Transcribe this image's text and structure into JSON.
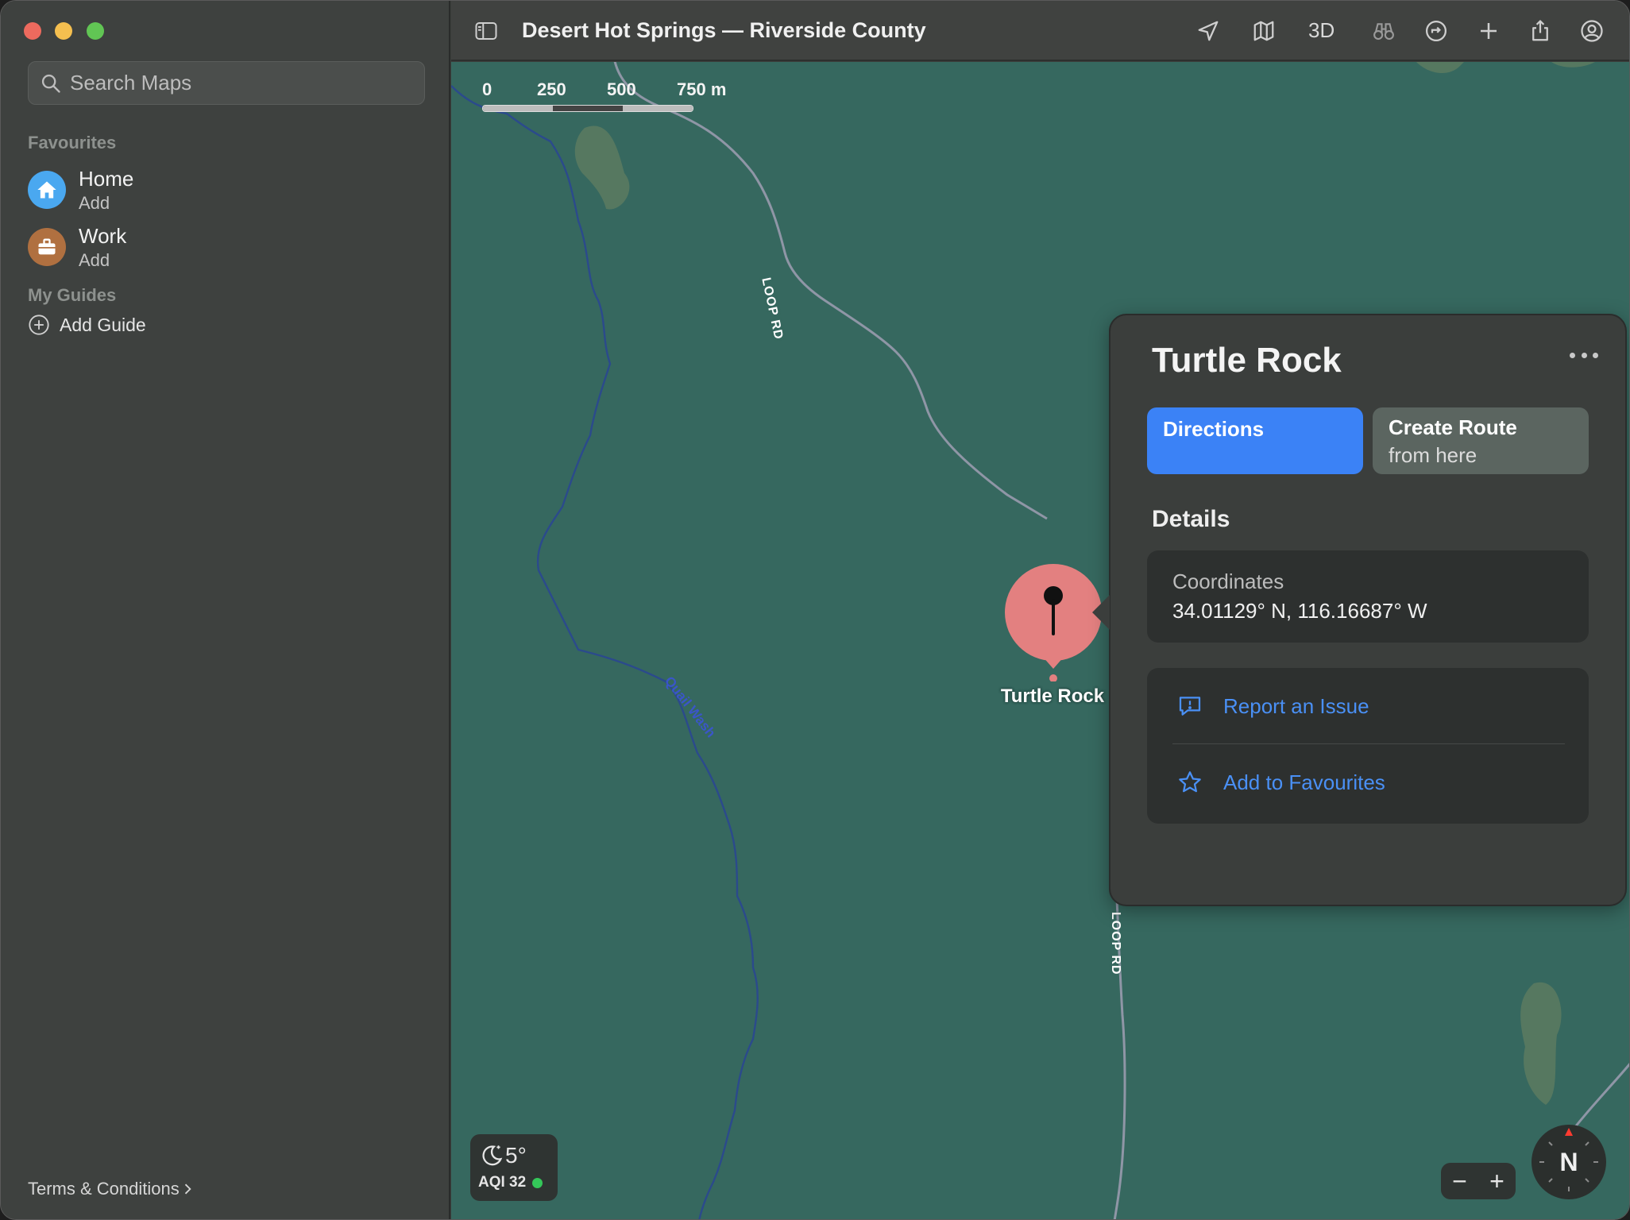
{
  "window": {
    "title": "Desert Hot Springs — Riverside County"
  },
  "sidebar": {
    "search_placeholder": "Search Maps",
    "favourites_label": "Favourites",
    "favourites": [
      {
        "title": "Home",
        "subtitle": "Add",
        "icon": "house-icon",
        "color": "#4aa8f0"
      },
      {
        "title": "Work",
        "subtitle": "Add",
        "icon": "briefcase-icon",
        "color": "#b07040"
      }
    ],
    "guides_label": "My Guides",
    "add_guide": "Add Guide",
    "terms": "Terms & Conditions"
  },
  "toolbar": {
    "sidebar_toggle": "sidebar-icon",
    "items": [
      "location-arrow-icon",
      "map-icon",
      "3D",
      "binoculars-icon",
      "rotate-icon",
      "plus-icon",
      "share-icon",
      "account-icon"
    ],
    "three_d_label": "3D"
  },
  "map": {
    "scale": {
      "labels": [
        "0",
        "250",
        "500",
        "750 m"
      ]
    },
    "road_labels": [
      "LOOP RD",
      "LOOP RD"
    ],
    "wash_label": "Quail Wash",
    "pin_label": "Turtle Rock",
    "weather": {
      "temperature": "5°",
      "aqi": "AQI 32",
      "aqi_color": "#34c759",
      "icon": "moon-stars-icon"
    },
    "zoom": {
      "minus": "−",
      "plus": "+"
    },
    "compass": "N"
  },
  "place_card": {
    "title": "Turtle Rock",
    "directions_label": "Directions",
    "create_route_line1": "Create Route",
    "create_route_line2": "from here",
    "details_heading": "Details",
    "coordinates_label": "Coordinates",
    "coordinates_value": "34.01129° N, 116.16687° W",
    "report_issue": "Report an Issue",
    "add_favourites": "Add to Favourites",
    "accent": "#3b82f6"
  }
}
